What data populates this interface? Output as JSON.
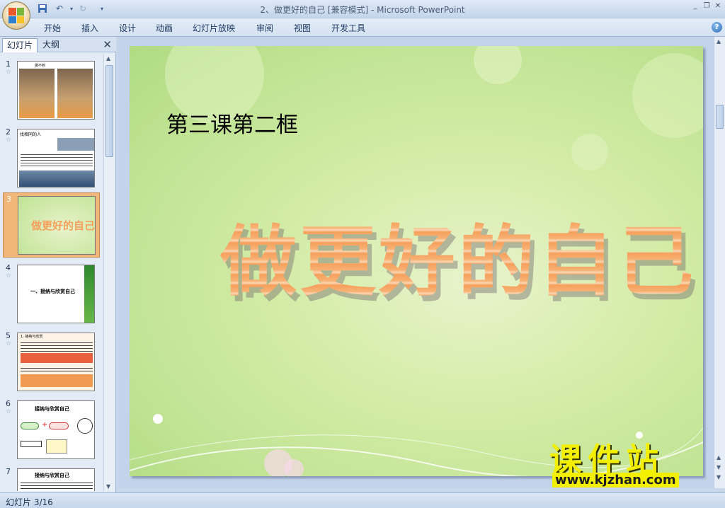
{
  "window": {
    "title": "2、做更好的自己 [兼容模式] - Microsoft PowerPoint"
  },
  "ribbon": {
    "tabs": [
      "开始",
      "插入",
      "设计",
      "动画",
      "幻灯片放映",
      "审阅",
      "视图",
      "开发工具"
    ]
  },
  "pane": {
    "tab_slides": "幻灯片",
    "tab_outline": "大纲",
    "slides": [
      {
        "num": "1",
        "caption": "做不到"
      },
      {
        "num": "2",
        "caption": "找相同的人"
      },
      {
        "num": "3",
        "caption": "做更好的自己",
        "selected": true
      },
      {
        "num": "4",
        "caption": "一、接纳与欣赏自己"
      },
      {
        "num": "5",
        "caption": "1. 接纳与欣赏"
      },
      {
        "num": "6",
        "caption": "接纳与欣赏自己"
      },
      {
        "num": "7",
        "caption": "接纳与欣赏自己"
      }
    ]
  },
  "slide": {
    "lesson": "第三课第二框",
    "title": "做更好的自己"
  },
  "status": {
    "text": "幻灯片 3/16"
  },
  "watermark": {
    "brand": "课件站",
    "url": "www.kjzhan.com"
  },
  "colors": {
    "selected_slide": "#f1b679",
    "title_fill": "#f5a05c",
    "slide_bg": "#c8e69a",
    "watermark": "#f2f000"
  }
}
